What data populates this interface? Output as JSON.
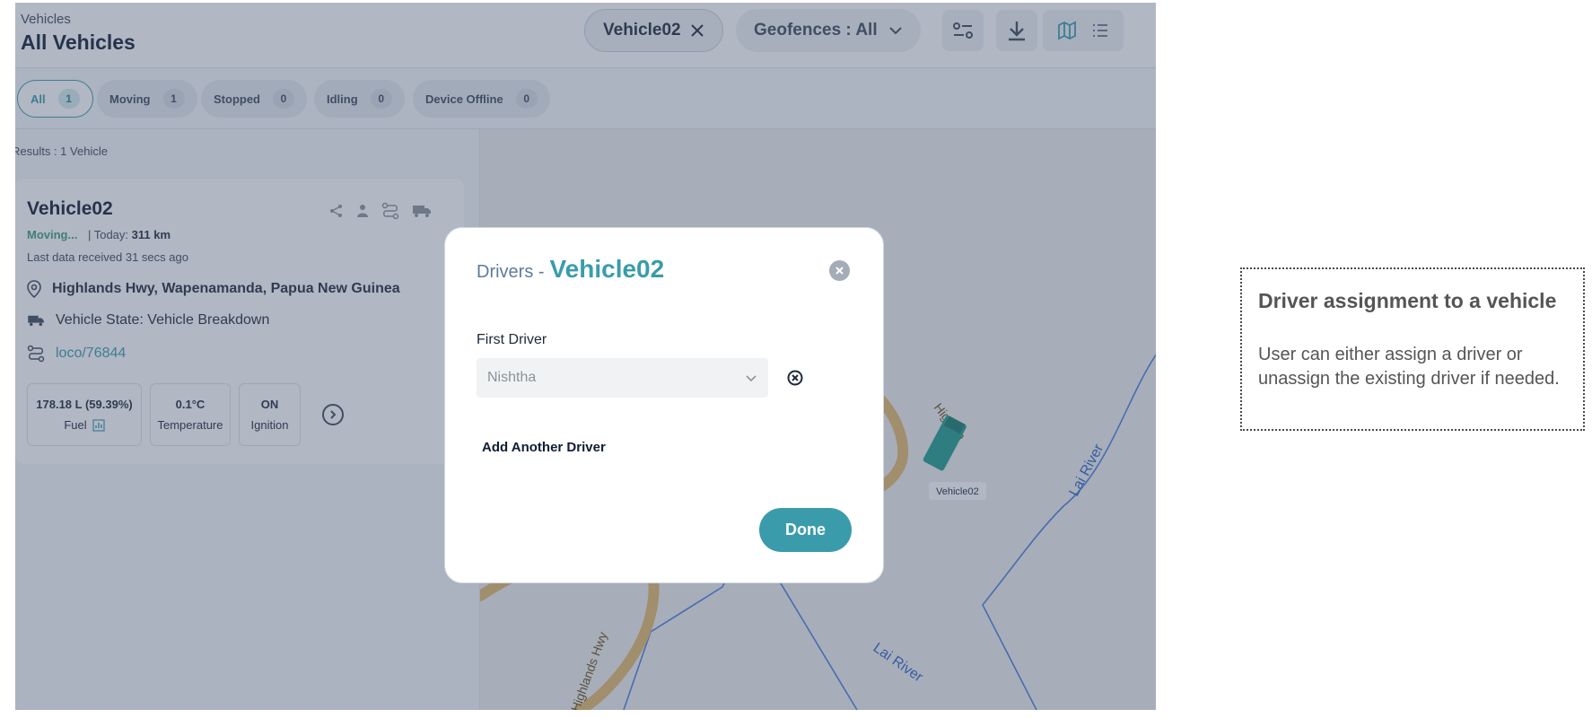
{
  "header": {
    "breadcrumb": "Vehicles",
    "title": "All Vehicles",
    "vehicle_filter": "Vehicle02",
    "geofence_filter": "Geofences : All"
  },
  "status_tabs": [
    {
      "label": "All",
      "count": "1"
    },
    {
      "label": "Moving",
      "count": "1"
    },
    {
      "label": "Stopped",
      "count": "0"
    },
    {
      "label": "Idling",
      "count": "0"
    },
    {
      "label": "Device Offline",
      "count": "0"
    }
  ],
  "list": {
    "results": "Results : 1 Vehicle",
    "vehicle": {
      "name": "Vehicle02",
      "status": "Moving...",
      "today_label": "| Today:",
      "today_value": "311 km",
      "last_data": "Last data received 31 secs ago",
      "address": "Highlands Hwy, Wapenamanda, Papua New Guinea",
      "state": "Vehicle State: Vehicle Breakdown",
      "route": "loco/76844",
      "stats": [
        {
          "value": "178.18 L (59.39%)",
          "label": "Fuel"
        },
        {
          "value": "0.1°C",
          "label": "Temperature"
        },
        {
          "value": "ON",
          "label": "Ignition"
        }
      ]
    }
  },
  "map": {
    "road_top": "Highlan",
    "road_bottom": "Highlands Hwy",
    "river_1": "Lai River",
    "river_2": "Lai River",
    "marker_label": "Vehicle02"
  },
  "modal": {
    "title_prefix": "Drivers -",
    "title_vehicle": "Vehicle02",
    "first_driver_label": "First Driver",
    "first_driver_value": "Nishtha",
    "add_driver": "Add Another Driver",
    "done": "Done"
  },
  "note": {
    "title": "Driver assignment to a vehicle",
    "body": "User can either assign a  driver or unassign the existing driver if needed."
  },
  "colors": {
    "accent": "#3a9cab",
    "moving": "#3aa07b",
    "overlay": "rgba(70,84,112,0.42)"
  }
}
